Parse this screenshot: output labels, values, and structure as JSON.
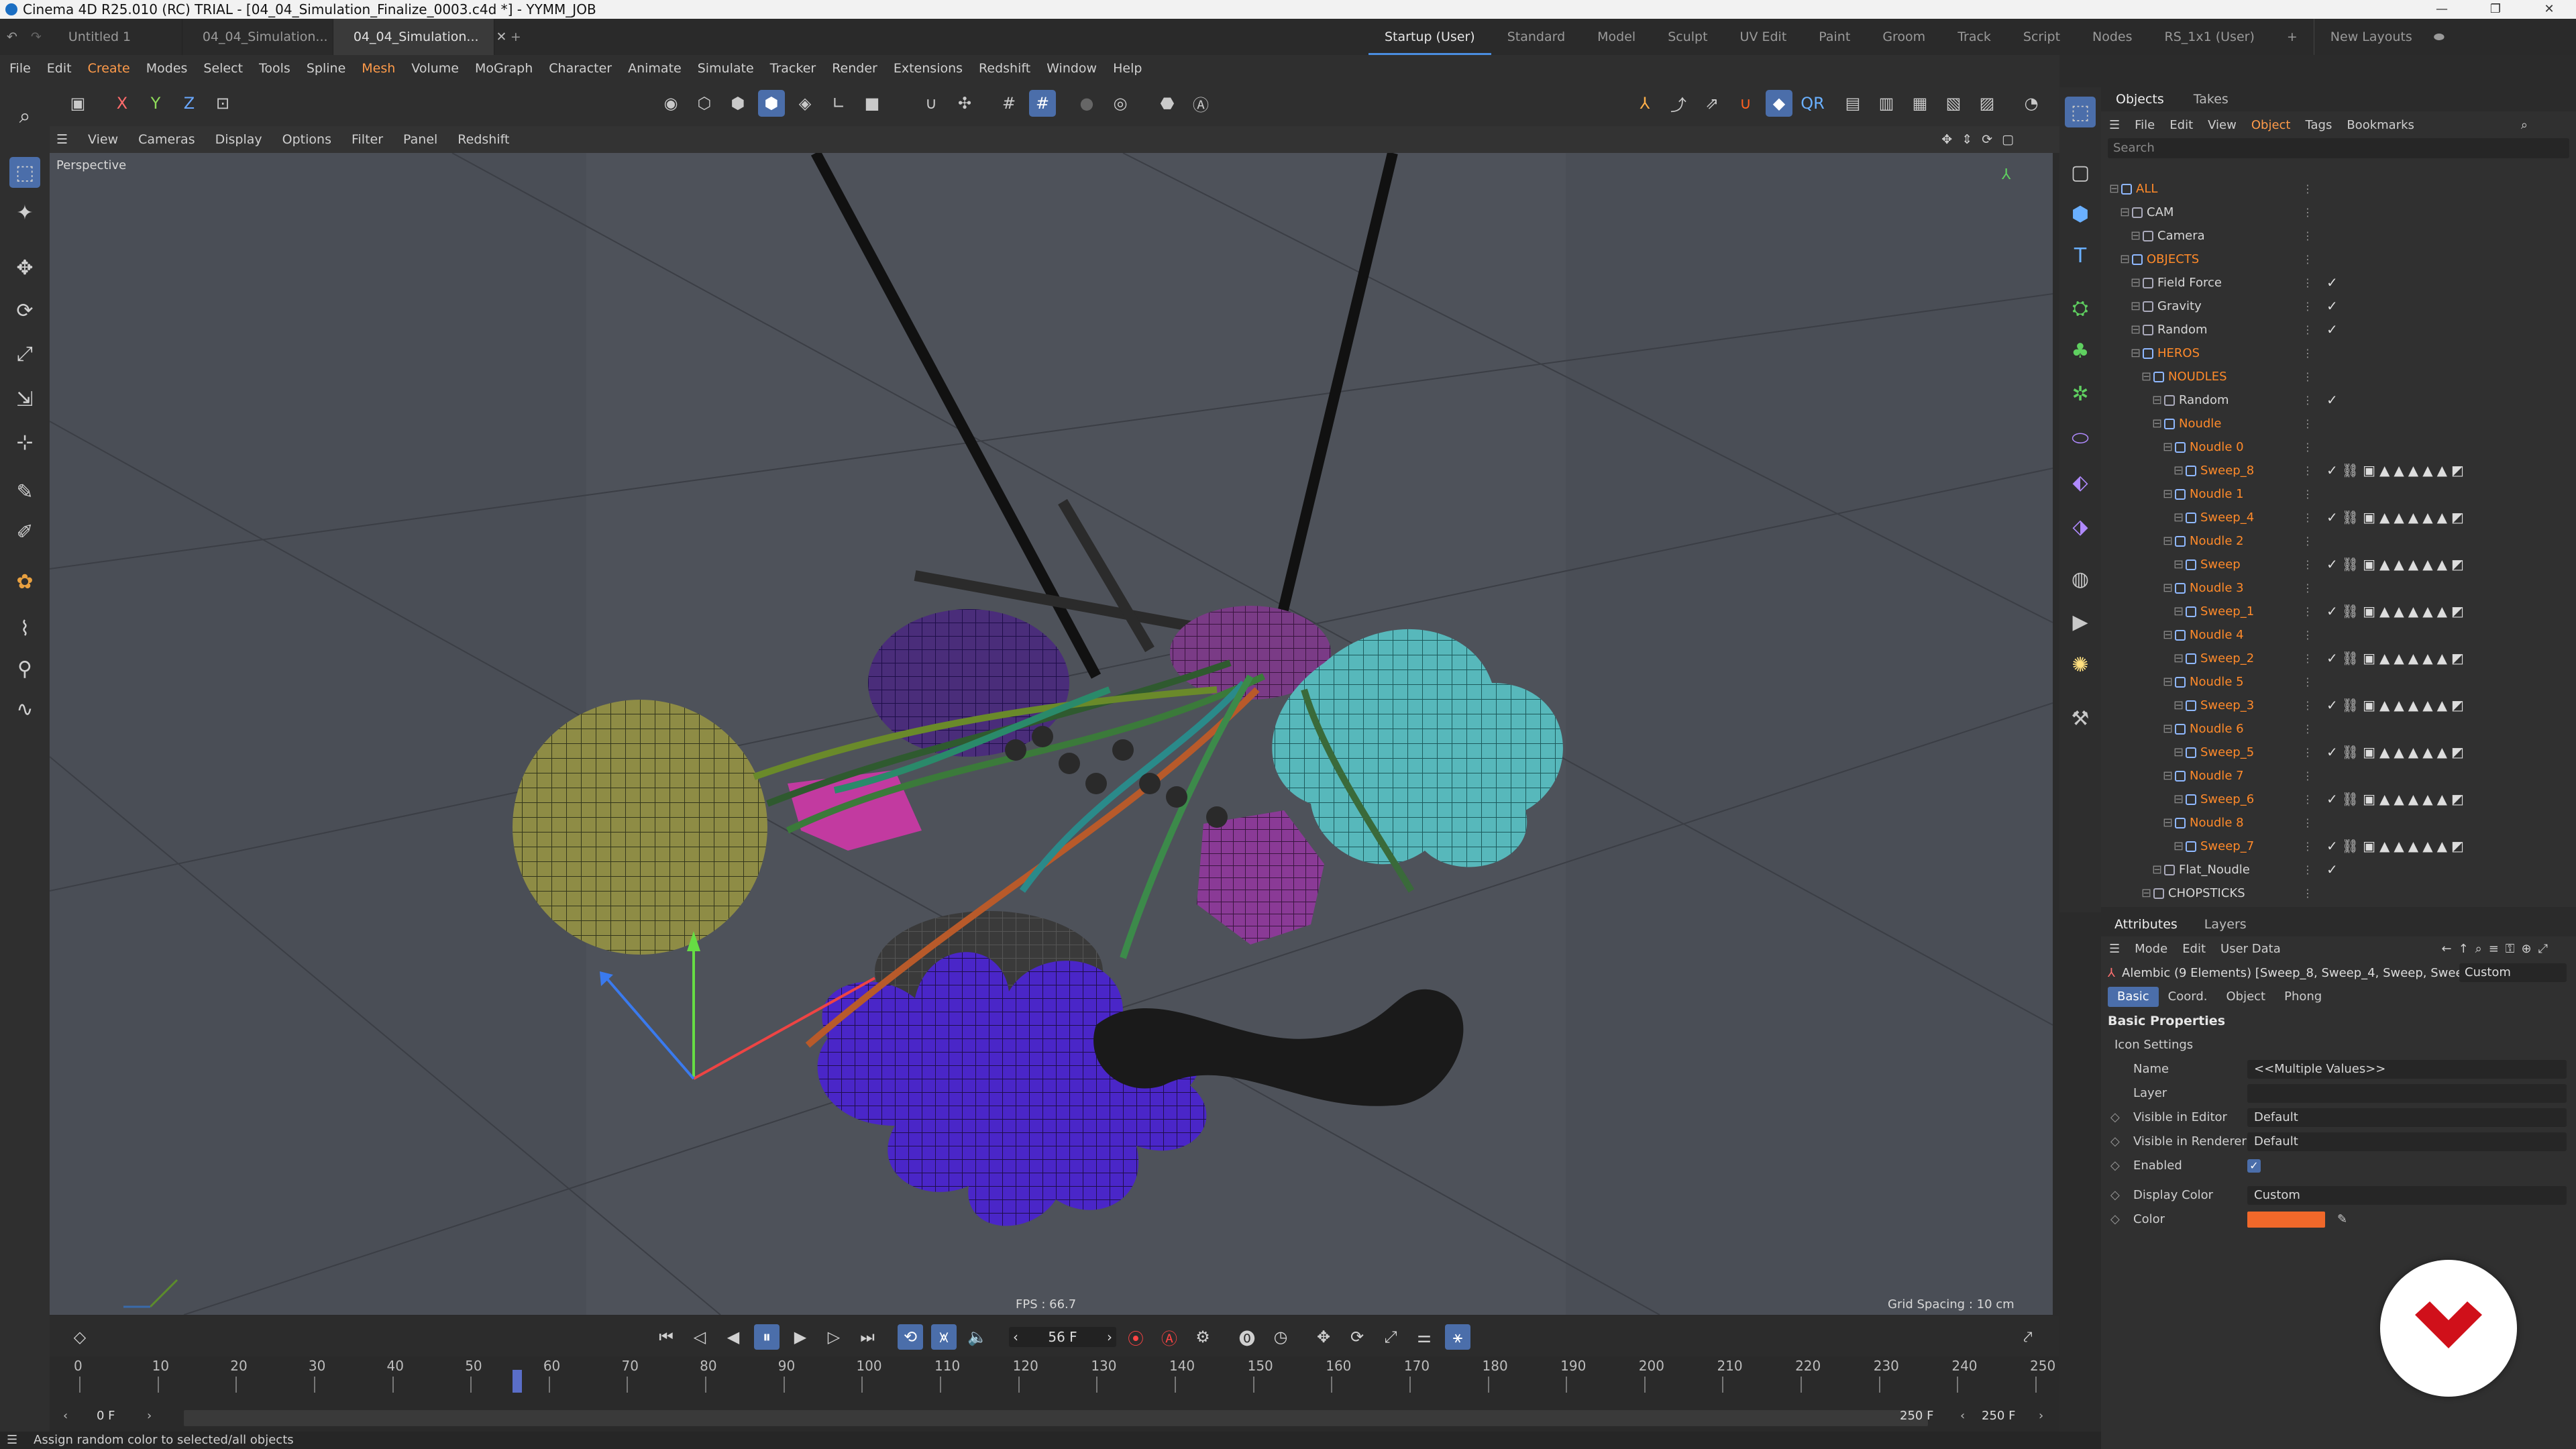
{
  "window": {
    "title": "Cinema 4D R25.010 (RC) TRIAL - [04_04_Simulation_Finalize_0003.c4d *] - YYMM_JOB"
  },
  "doc_tabs": [
    {
      "label": "Untitled 1"
    },
    {
      "label": "04_04_Simulation..."
    },
    {
      "label": "04_04_Simulation..."
    }
  ],
  "layout_tabs": [
    "Startup (User)",
    "Standard",
    "Model",
    "Sculpt",
    "UV Edit",
    "Paint",
    "Groom",
    "Track",
    "Script",
    "Nodes",
    "RS_1x1 (User)"
  ],
  "new_layouts": "New Layouts",
  "menu": [
    "File",
    "Edit",
    "Create",
    "Modes",
    "Select",
    "Tools",
    "Spline",
    "Mesh",
    "Volume",
    "MoGraph",
    "Character",
    "Animate",
    "Simulate",
    "Tracker",
    "Render",
    "Extensions",
    "Redshift",
    "Window",
    "Help"
  ],
  "toolbar": {
    "axis_x": "X",
    "axis_y": "Y",
    "axis_z": "Z"
  },
  "viewport": {
    "menu": [
      "View",
      "Cameras",
      "Display",
      "Options",
      "Filter",
      "Panel",
      "Redshift"
    ],
    "label": "Perspective",
    "fps": "FPS : 66.7",
    "grid_spacing": "Grid Spacing : 10 cm"
  },
  "timeline": {
    "current_frame": "56 F",
    "start_frame": "0 F",
    "start_field": "0 F",
    "end_frame": "250 F",
    "end_field": "250 F",
    "ticks": [
      "0",
      "10",
      "20",
      "30",
      "40",
      "50",
      "60",
      "70",
      "80",
      "90",
      "100",
      "110",
      "120",
      "130",
      "140",
      "150",
      "160",
      "170",
      "180",
      "190",
      "200",
      "210",
      "220",
      "230",
      "240",
      "250"
    ],
    "playhead_frame": 56
  },
  "objects": {
    "tabs": [
      "Objects",
      "Takes"
    ],
    "menu": [
      "File",
      "Edit",
      "View",
      "Object",
      "Tags",
      "Bookmarks"
    ],
    "search_placeholder": "Search",
    "tree": [
      {
        "name": "ALL",
        "depth": 0,
        "color": "orange"
      },
      {
        "name": "CAM",
        "depth": 1,
        "color": "light"
      },
      {
        "name": "Camera",
        "depth": 2,
        "color": "light"
      },
      {
        "name": "OBJECTS",
        "depth": 1,
        "color": "orange"
      },
      {
        "name": "Field Force",
        "depth": 2,
        "color": "light"
      },
      {
        "name": "Gravity",
        "depth": 2,
        "color": "light"
      },
      {
        "name": "Random",
        "depth": 2,
        "color": "light"
      },
      {
        "name": "HEROS",
        "depth": 2,
        "color": "orange"
      },
      {
        "name": "NOUDLES",
        "depth": 3,
        "color": "orange"
      },
      {
        "name": "Random",
        "depth": 4,
        "color": "light"
      },
      {
        "name": "Noudle",
        "depth": 4,
        "color": "orange"
      },
      {
        "name": "Noudle 0",
        "depth": 5,
        "color": "orange"
      },
      {
        "name": "Sweep_8",
        "depth": 6,
        "color": "orange"
      },
      {
        "name": "Noudle 1",
        "depth": 5,
        "color": "orange"
      },
      {
        "name": "Sweep_4",
        "depth": 6,
        "color": "orange"
      },
      {
        "name": "Noudle 2",
        "depth": 5,
        "color": "orange"
      },
      {
        "name": "Sweep",
        "depth": 6,
        "color": "orange"
      },
      {
        "name": "Noudle 3",
        "depth": 5,
        "color": "orange"
      },
      {
        "name": "Sweep_1",
        "depth": 6,
        "color": "orange"
      },
      {
        "name": "Noudle 4",
        "depth": 5,
        "color": "orange"
      },
      {
        "name": "Sweep_2",
        "depth": 6,
        "color": "orange"
      },
      {
        "name": "Noudle 5",
        "depth": 5,
        "color": "orange"
      },
      {
        "name": "Sweep_3",
        "depth": 6,
        "color": "orange"
      },
      {
        "name": "Noudle 6",
        "depth": 5,
        "color": "orange"
      },
      {
        "name": "Sweep_5",
        "depth": 6,
        "color": "orange"
      },
      {
        "name": "Noudle 7",
        "depth": 5,
        "color": "orange"
      },
      {
        "name": "Sweep_6",
        "depth": 6,
        "color": "orange"
      },
      {
        "name": "Noudle 8",
        "depth": 5,
        "color": "orange"
      },
      {
        "name": "Sweep_7",
        "depth": 6,
        "color": "orange"
      },
      {
        "name": "Flat_Noudle",
        "depth": 4,
        "color": "light"
      },
      {
        "name": "CHOPSTICKS",
        "depth": 3,
        "color": "light"
      }
    ]
  },
  "attributes": {
    "tabs": [
      "Attributes",
      "Layers"
    ],
    "menu": [
      "Mode",
      "Edit",
      "User Data"
    ],
    "description": "Alembic (9 Elements) [Sweep_8, Sweep_4, Sweep, Swee",
    "mode": "Custom",
    "subtabs": [
      "Basic",
      "Coord.",
      "Object",
      "Phong"
    ],
    "section": "Basic Properties",
    "icon_settings": "Icon Settings",
    "fields": {
      "name_label": "Name",
      "name_value": "<<Multiple Values>>",
      "layer_label": "Layer",
      "layer_value": "",
      "vis_editor_label": "Visible in Editor",
      "vis_editor_value": "Default",
      "vis_render_label": "Visible in Renderer",
      "vis_render_value": "Default",
      "enabled_label": "Enabled",
      "enabled_value": "✓",
      "display_color_label": "Display Color",
      "display_color_value": "Custom",
      "color_label": "Color"
    },
    "swatch_color": "#f0682a"
  },
  "status": "Assign random color to selected/all objects",
  "colors": {
    "accent": "#4b6eaa",
    "orange": "#ff8a2a"
  }
}
